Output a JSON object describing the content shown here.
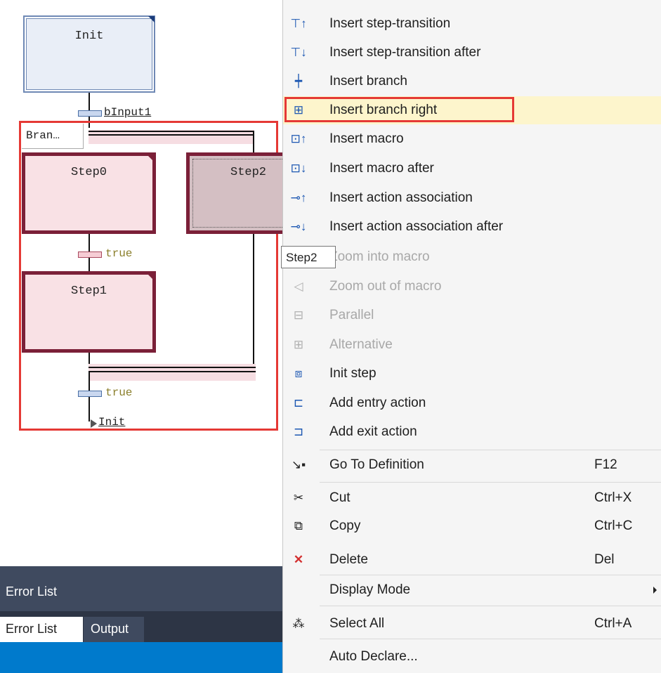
{
  "editor": {
    "init_step": "Init",
    "transition_1": "bInput1",
    "branch_label": "Bran…",
    "step0": "Step0",
    "step1": "Step1",
    "step2": "Step2",
    "transition_2": "true",
    "transition_3": "true",
    "jump_target": "Init",
    "tooltip": "Step2"
  },
  "panel": {
    "error_list_title": "Error List",
    "tabs": [
      "Error List",
      "Output"
    ]
  },
  "menu": {
    "items": [
      {
        "label": "Insert step-transition",
        "icon": "insert-step-transition-icon"
      },
      {
        "label": "Insert step-transition after",
        "icon": "insert-step-transition-after-icon"
      },
      {
        "label": "Insert branch",
        "icon": "insert-branch-icon"
      },
      {
        "label": "Insert branch right",
        "icon": "insert-branch-right-icon",
        "highlighted": true
      },
      {
        "label": "Insert macro",
        "icon": "insert-macro-icon"
      },
      {
        "label": "Insert macro after",
        "icon": "insert-macro-after-icon"
      },
      {
        "label": "Insert action association",
        "icon": "insert-action-association-icon"
      },
      {
        "label": "Insert action association after",
        "icon": "insert-action-association-after-icon"
      },
      {
        "label": "Zoom into macro",
        "icon": "zoom-into-macro-icon",
        "disabled": true
      },
      {
        "label": "Zoom out of macro",
        "icon": "zoom-out-of-macro-icon",
        "disabled": true
      },
      {
        "label": "Parallel",
        "icon": "parallel-icon",
        "disabled": true
      },
      {
        "label": "Alternative",
        "icon": "alternative-icon",
        "disabled": true
      },
      {
        "label": "Init step",
        "icon": "init-step-icon"
      },
      {
        "label": "Add entry action",
        "icon": "add-entry-action-icon"
      },
      {
        "label": "Add exit action",
        "icon": "add-exit-action-icon"
      },
      {
        "label": "Go To Definition",
        "shortcut": "F12",
        "icon": "go-to-definition-icon"
      },
      {
        "label": "Cut",
        "shortcut": "Ctrl+X",
        "icon": "cut-icon"
      },
      {
        "label": "Copy",
        "shortcut": "Ctrl+C",
        "icon": "copy-icon"
      },
      {
        "label": "Delete",
        "shortcut": "Del",
        "icon": "delete-icon"
      },
      {
        "label": "Display Mode",
        "icon": "display-mode-icon",
        "submenu": true
      },
      {
        "label": "Select All",
        "shortcut": "Ctrl+A",
        "icon": "select-all-icon"
      },
      {
        "label": "Auto Declare...",
        "icon": "auto-declare-icon"
      }
    ]
  },
  "colors": {
    "highlight_border": "#e53935",
    "menu_highlight": "#fdf5cc",
    "step_fill": "#f9e1e5",
    "step_border": "#7b2038",
    "init_fill": "#e9eef7",
    "init_border": "#6f89b5"
  }
}
